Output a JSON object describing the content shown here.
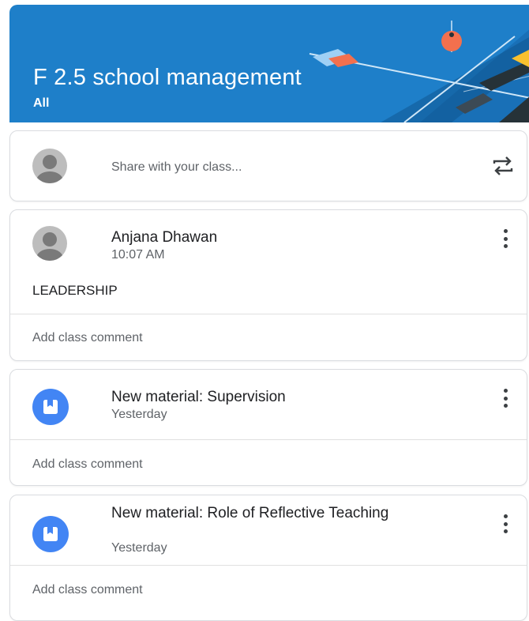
{
  "header": {
    "title": "F 2.5 school management",
    "subtitle": "All",
    "background_color": "#1e7fc9"
  },
  "share": {
    "placeholder": "Share with your class...",
    "avatar_icon": "person-icon",
    "action_icon": "repost-icon"
  },
  "posts": [
    {
      "author": "Anjana Dhawan",
      "time": "10:07 AM",
      "text": "LEADERSHIP",
      "comment_label": "Add class comment"
    }
  ],
  "materials": [
    {
      "title": "New material: Supervision",
      "date": "Yesterday",
      "comment_label": "Add class comment",
      "icon": "material-bookmark-icon"
    },
    {
      "title": "New material: Role of Reflective Teaching",
      "date": "Yesterday",
      "comment_label": "Add class comment",
      "icon": "material-bookmark-icon"
    }
  ],
  "colors": {
    "accent_blue": "#4285f4",
    "banner_orange": "#f2704e"
  }
}
